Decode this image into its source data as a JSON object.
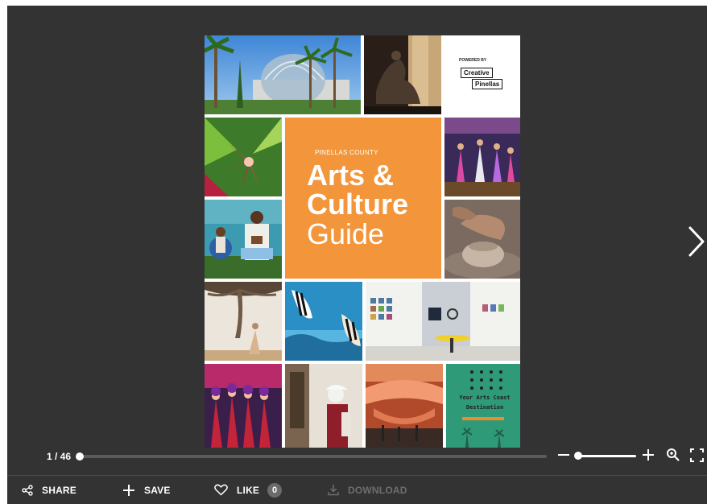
{
  "viewer": {
    "cover": {
      "subtitle": "PINELLAS COUNTY",
      "title_line1": "Arts &",
      "title_line2": "Culture",
      "title_line3": "Guide",
      "powered_by": "POWERED BY",
      "logo_word1": "Creative",
      "logo_word2": "Pinellas",
      "destination_line1": "Your Arts Coast",
      "destination_line2": "Destination"
    },
    "next_icon": "chevron-right-icon"
  },
  "controls": {
    "page_counter": "1 / 46",
    "progress": 0.0,
    "zoom_level": 0.05
  },
  "toolbar": {
    "share_label": "SHARE",
    "save_label": "SAVE",
    "like_label": "LIKE",
    "like_count": "0",
    "download_label": "DOWNLOAD"
  },
  "colors": {
    "background": "#333333",
    "cover_orange": "#f3953a",
    "teal_tile": "#2f9a78"
  }
}
